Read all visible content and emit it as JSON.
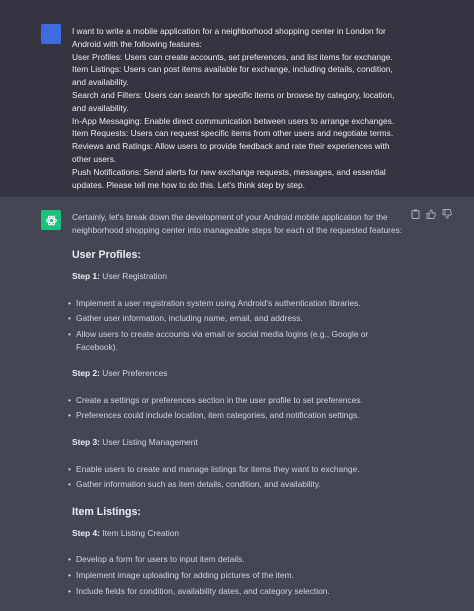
{
  "user_message": {
    "lines": [
      "I want to write a mobile application for a neighborhood shopping center in London for Android with the following features:",
      "User Profiles: Users can create accounts, set preferences, and list items for exchange.",
      "Item Listings: Users can post items available for exchange, including details, condition, and availability.",
      "Search and Filters: Users can search for specific items or browse by category, location, and availability.",
      "In-App Messaging: Enable direct communication between users to arrange exchanges.",
      "Item Requests: Users can request specific items from other users and negotiate terms.",
      "Reviews and Ratings: Allow users to provide feedback and rate their experiences with other users.",
      "Push Notifications: Send alerts for new exchange requests, messages, and essential updates. Please tell me how to do this. Let's think step by step."
    ]
  },
  "assistant_message": {
    "intro": "Certainly, let's break down the development of your Android mobile application for the neighborhood shopping center into manageable steps for each of the requested features:",
    "sections": [
      {
        "heading": "User Profiles:",
        "steps": [
          {
            "label": "Step 1:",
            "title": "User Registration",
            "bullets": [
              "Implement a user registration system using Android's authentication libraries.",
              "Gather user information, including name, email, and address.",
              "Allow users to create accounts via email or social media logins (e.g., Google or Facebook)."
            ]
          },
          {
            "label": "Step 2:",
            "title": "User Preferences",
            "bullets": [
              "Create a settings or preferences section in the user profile to set preferences.",
              "Preferences could include location, item categories, and notification settings."
            ]
          },
          {
            "label": "Step 3:",
            "title": "User Listing Management",
            "bullets": [
              "Enable users to create and manage listings for items they want to exchange.",
              "Gather information such as item details, condition, and availability."
            ]
          }
        ]
      },
      {
        "heading": "Item Listings:",
        "steps": [
          {
            "label": "Step 4:",
            "title": "Item Listing Creation",
            "bullets": [
              "Develop a form for users to input item details.",
              "Implement image uploading for adding pictures of the item.",
              "Include fields for condition, availability dates, and category selection."
            ]
          }
        ]
      }
    ]
  },
  "actions": {
    "copy_icon": "clipboard-icon",
    "like_icon": "thumbs-up-icon",
    "dislike_icon": "thumbs-down-icon"
  },
  "colors": {
    "user_bg": "#343541",
    "assistant_bg": "#444654",
    "user_avatar": "#3d6be0",
    "gpt_avatar": "#19c37d"
  }
}
